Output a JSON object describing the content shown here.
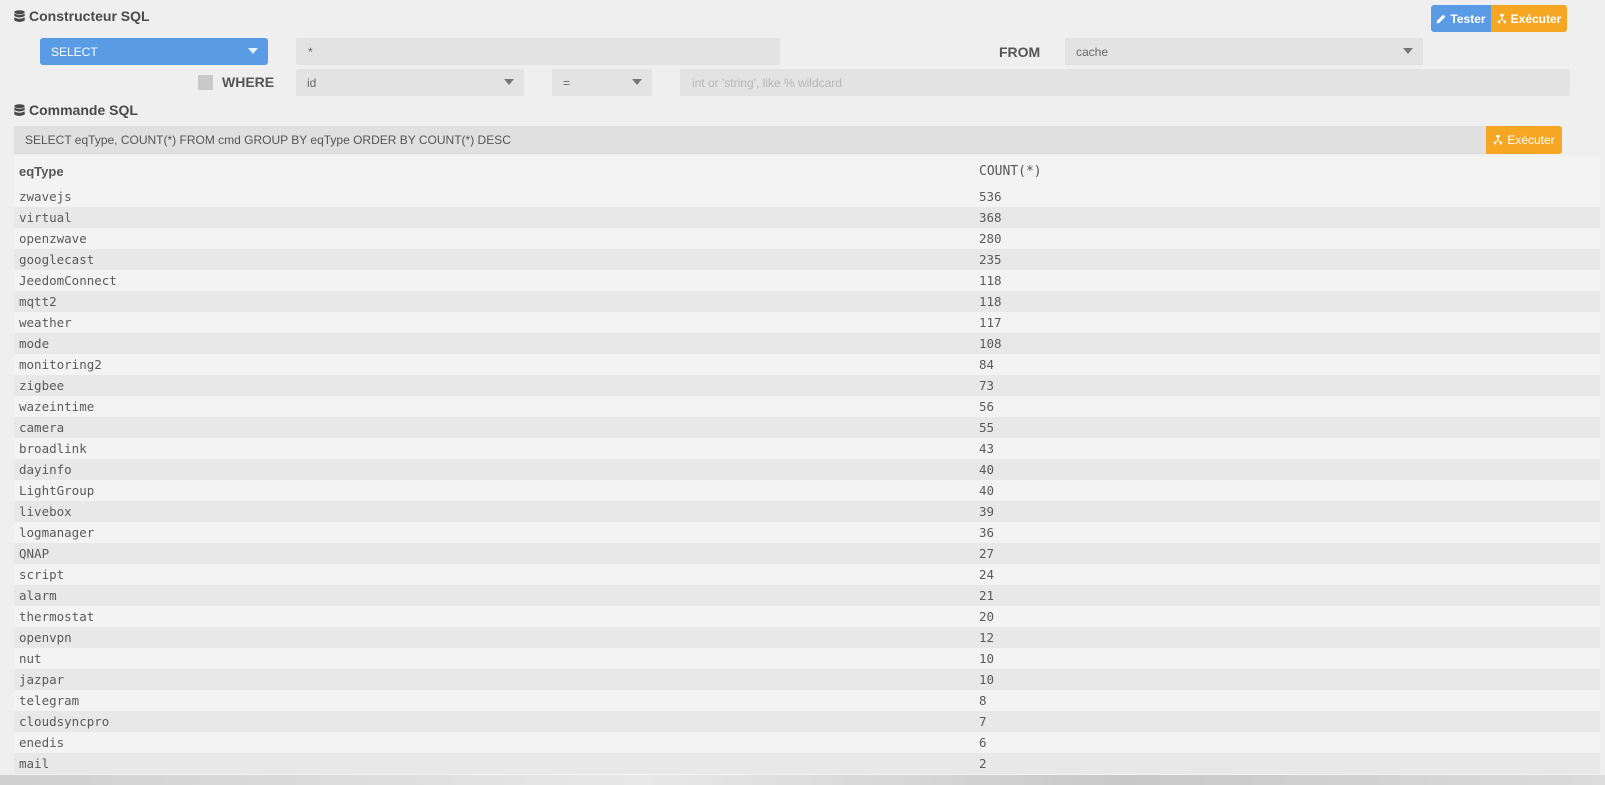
{
  "builder": {
    "title": "Constructeur SQL",
    "tester_label": "Tester",
    "executer_label": "Exécuter",
    "statement_select": "SELECT",
    "columns_value": "*",
    "from_label": "FROM",
    "from_table": "cache",
    "where_label": "WHERE",
    "where_field": "id",
    "where_operator": "=",
    "where_value_placeholder": "int or 'string', like % wildcard"
  },
  "command": {
    "title": "Commande SQL",
    "query": "SELECT eqType, COUNT(*) FROM cmd GROUP BY eqType ORDER BY COUNT(*) DESC",
    "executer_label": "Exécuter"
  },
  "results": {
    "columns": [
      "eqType",
      "COUNT(*)"
    ],
    "rows": [
      [
        "zwavejs",
        "536"
      ],
      [
        "virtual",
        "368"
      ],
      [
        "openzwave",
        "280"
      ],
      [
        "googlecast",
        "235"
      ],
      [
        "JeedomConnect",
        "118"
      ],
      [
        "mqtt2",
        "118"
      ],
      [
        "weather",
        "117"
      ],
      [
        "mode",
        "108"
      ],
      [
        "monitoring2",
        "84"
      ],
      [
        "zigbee",
        "73"
      ],
      [
        "wazeintime",
        "56"
      ],
      [
        "camera",
        "55"
      ],
      [
        "broadlink",
        "43"
      ],
      [
        "dayinfo",
        "40"
      ],
      [
        "LightGroup",
        "40"
      ],
      [
        "livebox",
        "39"
      ],
      [
        "logmanager",
        "36"
      ],
      [
        "QNAP",
        "27"
      ],
      [
        "script",
        "24"
      ],
      [
        "alarm",
        "21"
      ],
      [
        "thermostat",
        "20"
      ],
      [
        "openvpn",
        "12"
      ],
      [
        "nut",
        "10"
      ],
      [
        "jazpar",
        "10"
      ],
      [
        "telegram",
        "8"
      ],
      [
        "cloudsyncpro",
        "7"
      ],
      [
        "enedis",
        "6"
      ],
      [
        "mail",
        "2"
      ]
    ]
  },
  "colors": {
    "accent_blue": "#5a9be6",
    "accent_orange": "#f5a623"
  }
}
